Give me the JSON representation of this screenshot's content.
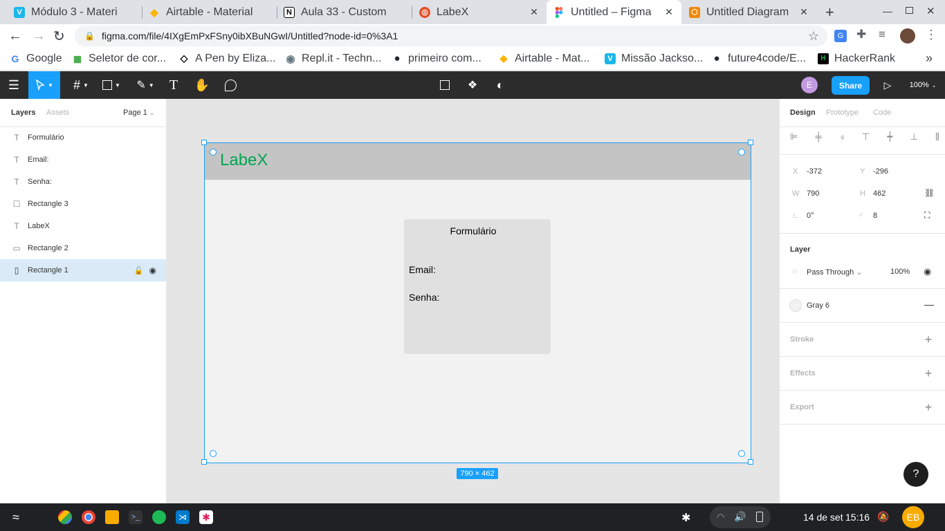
{
  "browser": {
    "tabs": [
      {
        "title": "Módulo 3 - Materi",
        "icon": "vimeo-icon",
        "color": "#1ab7ea",
        "glyph": "V",
        "active": false
      },
      {
        "title": "Airtable - Material",
        "icon": "airtable-icon",
        "color": "#fcb400",
        "glyph": "◆",
        "active": false
      },
      {
        "title": "Aula 33 - Custom",
        "icon": "notion-icon",
        "color": "#000000",
        "glyph": "N",
        "active": false
      },
      {
        "title": "LabeX",
        "icon": "codesandbox-icon",
        "color": "#e44d26",
        "glyph": "◎",
        "active": false
      },
      {
        "title": "Untitled – Figma",
        "icon": "figma-icon",
        "color": "#f24e1e",
        "glyph": "✦",
        "active": true
      },
      {
        "title": "Untitled Diagram",
        "icon": "drawio-icon",
        "color": "#f08705",
        "glyph": "⬡",
        "active": false
      }
    ],
    "new_tab": "+",
    "url": "figma.com/file/4IXgEmPxFSny0ibXBuNGwI/Untitled?node-id=0%3A1",
    "bookmarks": [
      {
        "label": "Google",
        "icon": "google-icon",
        "glyph": "G",
        "color": "#4285f4"
      },
      {
        "label": "Seletor de cor...",
        "icon": "color-picker-icon",
        "glyph": "◼",
        "color": "#4caf50"
      },
      {
        "label": "A Pen by Eliza...",
        "icon": "codepen-icon",
        "glyph": "◇",
        "color": "#000000"
      },
      {
        "label": "Repl.it - Techn...",
        "icon": "replit-icon",
        "glyph": "◉",
        "color": "#667881"
      },
      {
        "label": "primeiro com...",
        "icon": "github-icon",
        "glyph": "●",
        "color": "#24292e"
      },
      {
        "label": "Airtable - Mat...",
        "icon": "airtable-icon",
        "glyph": "◆",
        "color": "#fcb400"
      },
      {
        "label": "Missão Jackso...",
        "icon": "vimeo-icon",
        "glyph": "V",
        "color": "#1ab7ea"
      },
      {
        "label": "future4code/E...",
        "icon": "github-icon",
        "glyph": "●",
        "color": "#24292e"
      },
      {
        "label": "HackerRank",
        "icon": "hackerrank-icon",
        "glyph": "H",
        "color": "#1ba94c"
      }
    ],
    "bookmarks_more": "»"
  },
  "figma": {
    "share": "Share",
    "zoom": "100%",
    "avatar_initial": "E",
    "left_tabs": {
      "layers": "Layers",
      "assets": "Assets",
      "page": "Page 1"
    },
    "layers": [
      {
        "name": "Formulário",
        "type": "text",
        "icon": "text-layer-icon"
      },
      {
        "name": "Email:",
        "type": "text",
        "icon": "text-layer-icon"
      },
      {
        "name": "Senha:",
        "type": "text",
        "icon": "text-layer-icon"
      },
      {
        "name": "Rectangle 3",
        "type": "rect",
        "icon": "rectangle-layer-icon"
      },
      {
        "name": "LabeX",
        "type": "text",
        "icon": "text-layer-icon"
      },
      {
        "name": "Rectangle 2",
        "type": "rect",
        "icon": "rectangle-layer-icon"
      },
      {
        "name": "Rectangle 1",
        "type": "rect",
        "icon": "rectangle-layer-icon",
        "selected": true
      }
    ],
    "canvas": {
      "frame_title": "LabeX",
      "title_color": "#00a651",
      "form_title": "Formulário",
      "email_label": "Email:",
      "password_label": "Senha:",
      "size_badge": "790 × 462"
    },
    "right_tabs": {
      "design": "Design",
      "prototype": "Prototype",
      "code": "Code"
    },
    "props": {
      "x_label": "X",
      "x": "-372",
      "y_label": "Y",
      "y": "-296",
      "w_label": "W",
      "w": "790",
      "h_label": "H",
      "h": "462",
      "rotation": "0°",
      "radius": "8"
    },
    "layer_section": {
      "title": "Layer",
      "blend": "Pass Through",
      "opacity": "100%"
    },
    "fill": {
      "name": "Gray 6",
      "color": "#f2f2f2"
    },
    "sections": {
      "stroke": "Stroke",
      "effects": "Effects",
      "export": "Export"
    },
    "help": "?"
  },
  "taskbar": {
    "date": "14 de set",
    "time": "15:16",
    "user_initials": "EB"
  }
}
